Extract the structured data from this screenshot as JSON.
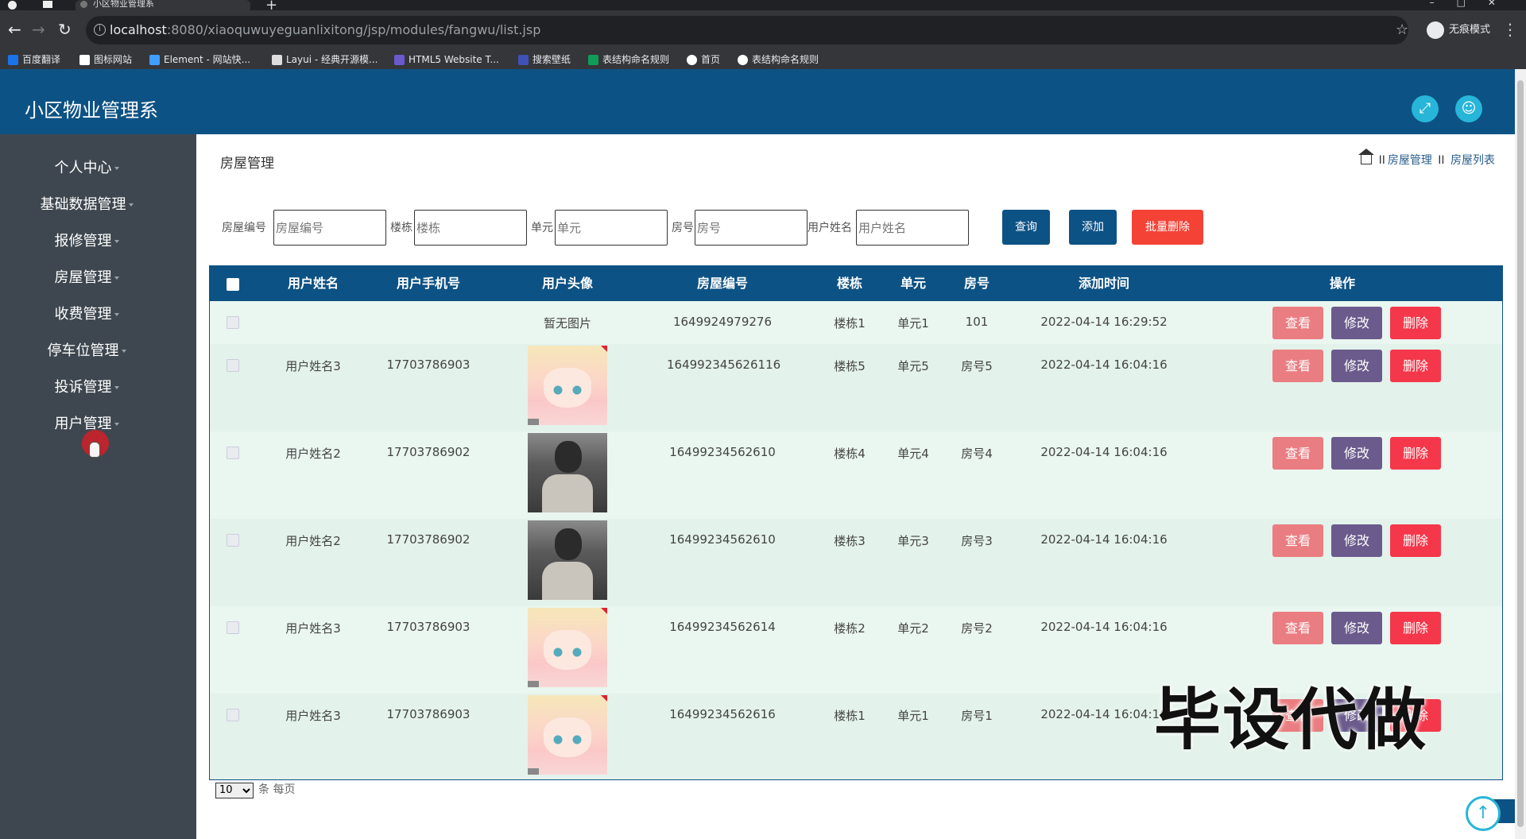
{
  "browser": {
    "tab_title": "小区物业管理系",
    "url_host": "localhost",
    "url_path": ":8080/xiaoquwuyeguanlixitong/jsp/modules/fangwu/list.jsp",
    "incognito_label": "无痕模式",
    "bookmarks": [
      {
        "label": "百度翻译",
        "color": "#1a73e8"
      },
      {
        "label": "图标网站",
        "color": "#ffffff"
      },
      {
        "label": "Element - 网站快...",
        "color": "#409eff"
      },
      {
        "label": "Layui - 经典开源模...",
        "color": "#dddddd"
      },
      {
        "label": "HTML5 Website T...",
        "color": "#6a5acd"
      },
      {
        "label": "搜索壁纸",
        "color": "#3f51b5"
      },
      {
        "label": "表结构命名规则",
        "color": "#0f9d58"
      },
      {
        "label": "首页",
        "color": "#ffffff"
      },
      {
        "label": "表结构命名规则",
        "color": "#ffffff"
      }
    ]
  },
  "header": {
    "title": "小区物业管理系",
    "fullscreen_icon": "expand-icon",
    "user_icon": "user-icon"
  },
  "sidebar": {
    "items": [
      {
        "label": "个人中心"
      },
      {
        "label": "基础数据管理"
      },
      {
        "label": "报修管理"
      },
      {
        "label": "房屋管理"
      },
      {
        "label": "收费管理"
      },
      {
        "label": "停车位管理"
      },
      {
        "label": "投诉管理"
      },
      {
        "label": "用户管理"
      }
    ]
  },
  "page": {
    "title": "房屋管理",
    "breadcrumb": [
      "房屋管理",
      "房屋列表"
    ]
  },
  "search": {
    "fields": [
      {
        "label": "房屋编号",
        "placeholder": "房屋编号"
      },
      {
        "label": "楼栋",
        "placeholder": "楼栋"
      },
      {
        "label": "单元",
        "placeholder": "单元"
      },
      {
        "label": "房号",
        "placeholder": "房号"
      },
      {
        "label": "用户姓名",
        "placeholder": "用户姓名"
      }
    ],
    "query_label": "查询",
    "add_label": "添加",
    "batch_delete_label": "批量删除"
  },
  "table": {
    "columns": [
      "用户姓名",
      "用户手机号",
      "用户头像",
      "房屋编号",
      "楼栋",
      "单元",
      "房号",
      "添加时间",
      "操作"
    ],
    "no_image_text": "暂无图片",
    "actions": {
      "view": "查看",
      "edit": "修改",
      "delete": "删除"
    },
    "rows": [
      {
        "name": "",
        "phone": "",
        "avatar": "none",
        "house_no": "1649924979276",
        "building": "楼栋1",
        "unit": "单元1",
        "room": "101",
        "time": "2022-04-14 16:29:52"
      },
      {
        "name": "用户姓名3",
        "phone": "17703786903",
        "avatar": "anime",
        "house_no": "164992345626116",
        "building": "楼栋5",
        "unit": "单元5",
        "room": "房号5",
        "time": "2022-04-14 16:04:16"
      },
      {
        "name": "用户姓名2",
        "phone": "17703786902",
        "avatar": "man",
        "house_no": "16499234562610",
        "building": "楼栋4",
        "unit": "单元4",
        "room": "房号4",
        "time": "2022-04-14 16:04:16"
      },
      {
        "name": "用户姓名2",
        "phone": "17703786902",
        "avatar": "man",
        "house_no": "16499234562610",
        "building": "楼栋3",
        "unit": "单元3",
        "room": "房号3",
        "time": "2022-04-14 16:04:16"
      },
      {
        "name": "用户姓名3",
        "phone": "17703786903",
        "avatar": "anime",
        "house_no": "16499234562614",
        "building": "楼栋2",
        "unit": "单元2",
        "room": "房号2",
        "time": "2022-04-14 16:04:16"
      },
      {
        "name": "用户姓名3",
        "phone": "17703786903",
        "avatar": "anime",
        "house_no": "16499234562616",
        "building": "楼栋1",
        "unit": "单元1",
        "room": "房号1",
        "time": "2022-04-14 16:04:16"
      }
    ]
  },
  "pager": {
    "page_size": "10",
    "per_page_label": "条 每页"
  },
  "watermark": "毕设代做",
  "colors": {
    "primary": "#0d5284",
    "sidebar_bg": "#3e474f",
    "danger": "#f44336",
    "accent": "#27b5d8"
  }
}
